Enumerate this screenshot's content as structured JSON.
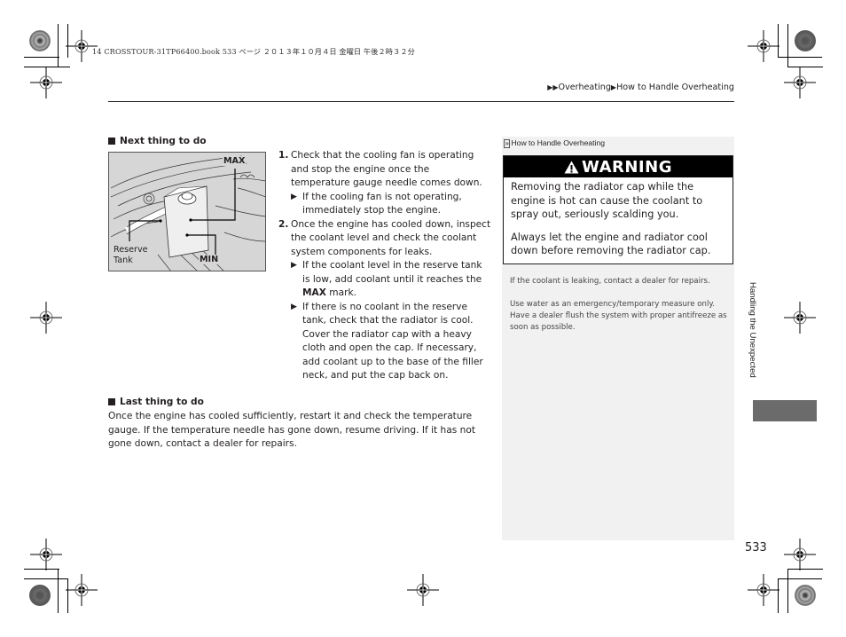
{
  "print_header": {
    "text": "14 CROSSTOUR-31TP66400.book  533 ページ  ２０１３年１０月４日  金曜日  午後２時３２分"
  },
  "breadcrumb": {
    "items": [
      "Overheating",
      "How to Handle Overheating"
    ]
  },
  "sections": {
    "next": {
      "heading": "Next thing to do",
      "figure": {
        "label_max": "MAX",
        "label_min": "MIN",
        "label_reserve_tank_line1": "Reserve",
        "label_reserve_tank_line2": "Tank"
      },
      "steps": [
        {
          "number": "1.",
          "text": "Check that the cooling fan is operating and stop the engine once the temperature gauge needle comes down.",
          "subs": [
            {
              "text": "If the cooling fan is not operating, immediately stop the engine."
            }
          ]
        },
        {
          "number": "2.",
          "text": "Once the engine has cooled down, inspect the coolant level and check the coolant system components for leaks.",
          "subs": [
            {
              "pre": "If the coolant level in the reserve tank is low, add coolant until it reaches the ",
              "bold": "MAX",
              "post": " mark."
            },
            {
              "text": "If there is no coolant in the reserve tank, check that the radiator is cool. Cover the radiator cap with a heavy cloth and open the cap. If necessary, add coolant up to the base of the filler neck, and put the cap back on."
            }
          ]
        }
      ]
    },
    "last": {
      "heading": "Last thing to do",
      "text": "Once the engine has cooled sufficiently, restart it and check the temperature gauge. If the temperature needle has gone down, resume driving. If it has not gone down, contact a dealer for repairs."
    }
  },
  "sidebar": {
    "ref_title": "How to Handle Overheating",
    "warning": {
      "title": "WARNING",
      "paragraphs": [
        "Removing the radiator cap while the engine is hot can cause the coolant to spray out, seriously scalding you.",
        "Always let the engine and radiator cool down before removing the radiator cap."
      ]
    },
    "notes": [
      "If the coolant is leaking, contact a dealer for repairs.",
      "Use water as an emergency/temporary measure only. Have a dealer flush the system with proper antifreeze as soon as possible."
    ]
  },
  "side_tab": {
    "label": "Handling the Unexpected",
    "color": "#6b6b6b"
  },
  "page_number": "533",
  "colors": {
    "text": "#231f20",
    "sidebar_bg": "#f1f1f1",
    "warning_header_bg": "#000000",
    "figure_bg": "#d6d6d6"
  }
}
